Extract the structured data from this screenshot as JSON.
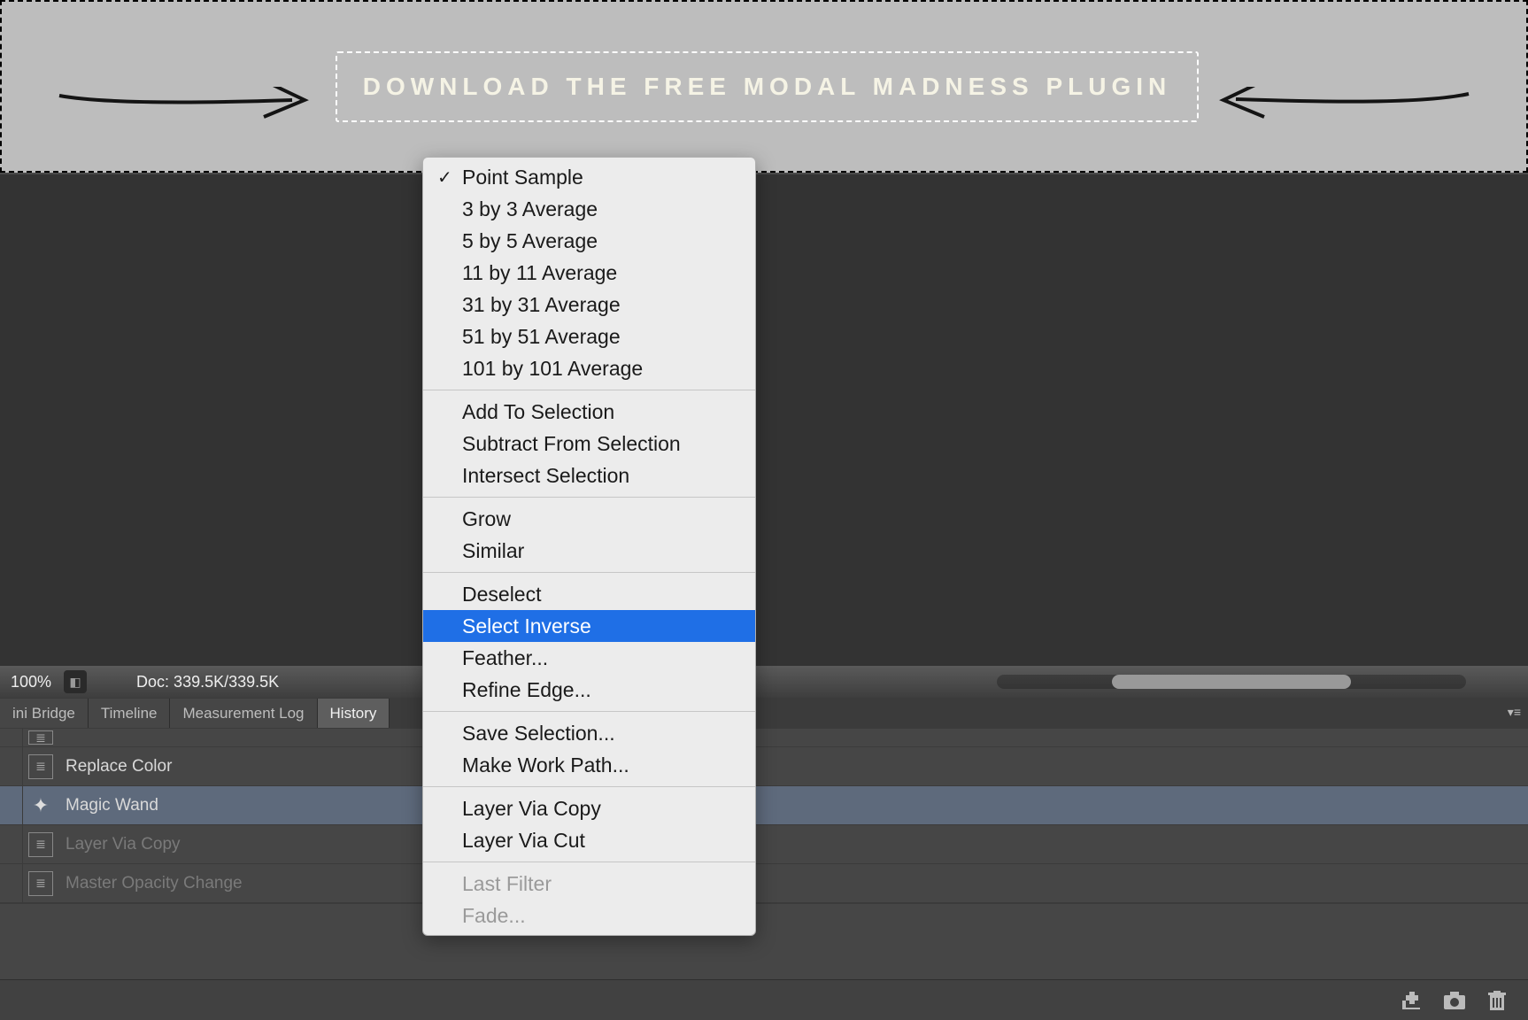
{
  "banner": {
    "cta_text": "DOWNLOAD THE FREE MODAL MADNESS PLUGIN"
  },
  "status": {
    "zoom": "100%",
    "doc": "Doc: 339.5K/339.5K"
  },
  "tabs": {
    "t0": "ini Bridge",
    "t1": "Timeline",
    "t2": "Measurement Log",
    "t3": "History"
  },
  "history": {
    "r0": "Replace Color",
    "r1": "Magic Wand",
    "r2": "Layer Via Copy",
    "r3": "Master Opacity Change"
  },
  "menu": {
    "g1": {
      "i0": "Point Sample",
      "i1": "3 by 3 Average",
      "i2": "5 by 5 Average",
      "i3": "11 by 11 Average",
      "i4": "31 by 31 Average",
      "i5": "51 by 51 Average",
      "i6": "101 by 101 Average"
    },
    "g2": {
      "i0": "Add To Selection",
      "i1": "Subtract From Selection",
      "i2": "Intersect Selection"
    },
    "g3": {
      "i0": "Grow",
      "i1": "Similar"
    },
    "g4": {
      "i0": "Deselect",
      "i1": "Select Inverse",
      "i2": "Feather...",
      "i3": "Refine Edge..."
    },
    "g5": {
      "i0": "Save Selection...",
      "i1": "Make Work Path..."
    },
    "g6": {
      "i0": "Layer Via Copy",
      "i1": "Layer Via Cut"
    },
    "g7": {
      "i0": "Last Filter",
      "i1": "Fade..."
    }
  }
}
